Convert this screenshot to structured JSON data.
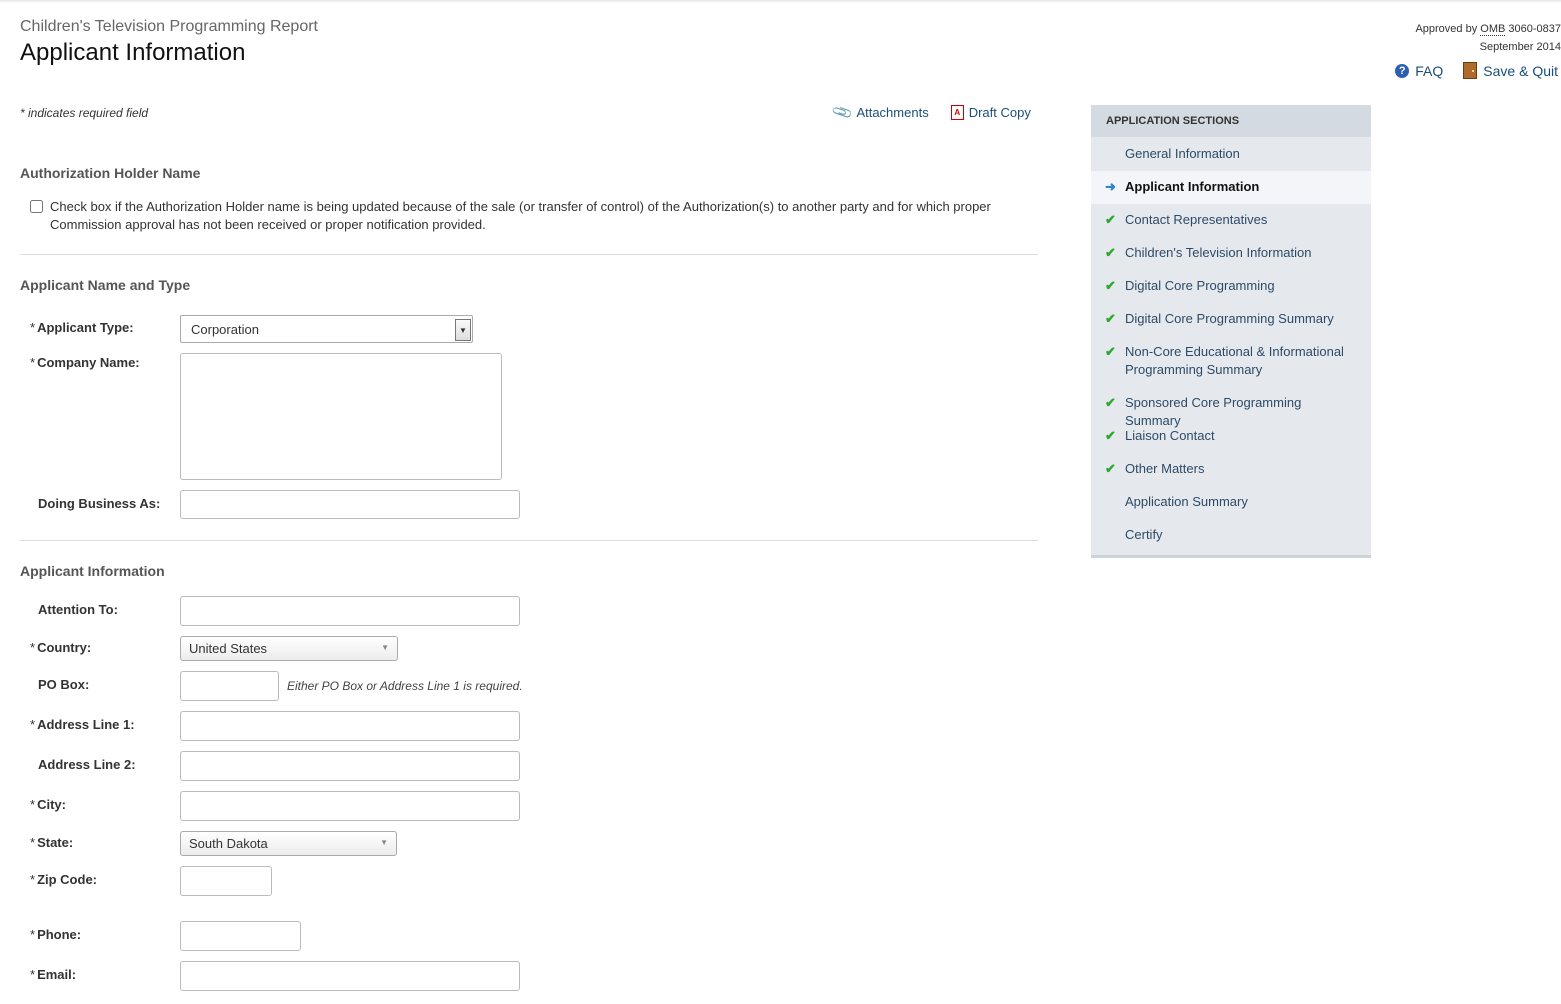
{
  "header": {
    "report_title": "Children's Television Programming Report",
    "page_title": "Applicant Information",
    "approved_prefix": "Approved by ",
    "approved_omb": "OMB",
    "approved_number": " 3060-0837",
    "approved_date": "September 2014",
    "faq_label": "FAQ",
    "save_quit_label": "Save & Quit"
  },
  "toolbar": {
    "required_note": "* indicates required field",
    "attachments_label": "Attachments",
    "draft_copy_label": "Draft Copy"
  },
  "auth_holder": {
    "heading": "Authorization Holder Name",
    "checkbox_text": "Check box if the Authorization Holder name is being updated because of the sale (or transfer of control) of the Authorization(s) to another party and for which proper Commission approval has not been received or proper notification provided."
  },
  "name_type": {
    "heading": "Applicant Name and Type",
    "applicant_type_label": "Applicant Type:",
    "applicant_type_value": "Corporation",
    "company_name_label": "Company Name:",
    "dba_label": "Doing Business As:"
  },
  "applicant_info": {
    "heading": "Applicant Information",
    "attention_label": "Attention To:",
    "country_label": "Country:",
    "country_value": "United States",
    "pobox_label": "PO Box:",
    "pobox_hint": "Either PO Box or Address Line 1 is required.",
    "address1_label": "Address Line 1:",
    "address2_label": "Address Line 2:",
    "city_label": "City:",
    "state_label": "State:",
    "state_value": "South Dakota",
    "zip_label": "Zip Code:",
    "phone_label": "Phone:",
    "email_label": "Email:"
  },
  "sidebar": {
    "heading": "Application Sections",
    "items": [
      {
        "label": "General Information",
        "status": "none"
      },
      {
        "label": "Applicant Information",
        "status": "current"
      },
      {
        "label": "Contact Representatives",
        "status": "complete"
      },
      {
        "label": "Children's Television Information",
        "status": "complete"
      },
      {
        "label": "Digital Core Programming",
        "status": "complete"
      },
      {
        "label": "Digital Core Programming Summary",
        "status": "complete"
      },
      {
        "label": "Non-Core Educational & Informational Programming Summary",
        "status": "complete"
      },
      {
        "label": "Sponsored Core Programming Summary",
        "status": "complete"
      },
      {
        "label": "Liaison Contact",
        "status": "complete"
      },
      {
        "label": "Other Matters",
        "status": "complete"
      },
      {
        "label": "Application Summary",
        "status": "none"
      },
      {
        "label": "Certify",
        "status": "none"
      }
    ]
  }
}
